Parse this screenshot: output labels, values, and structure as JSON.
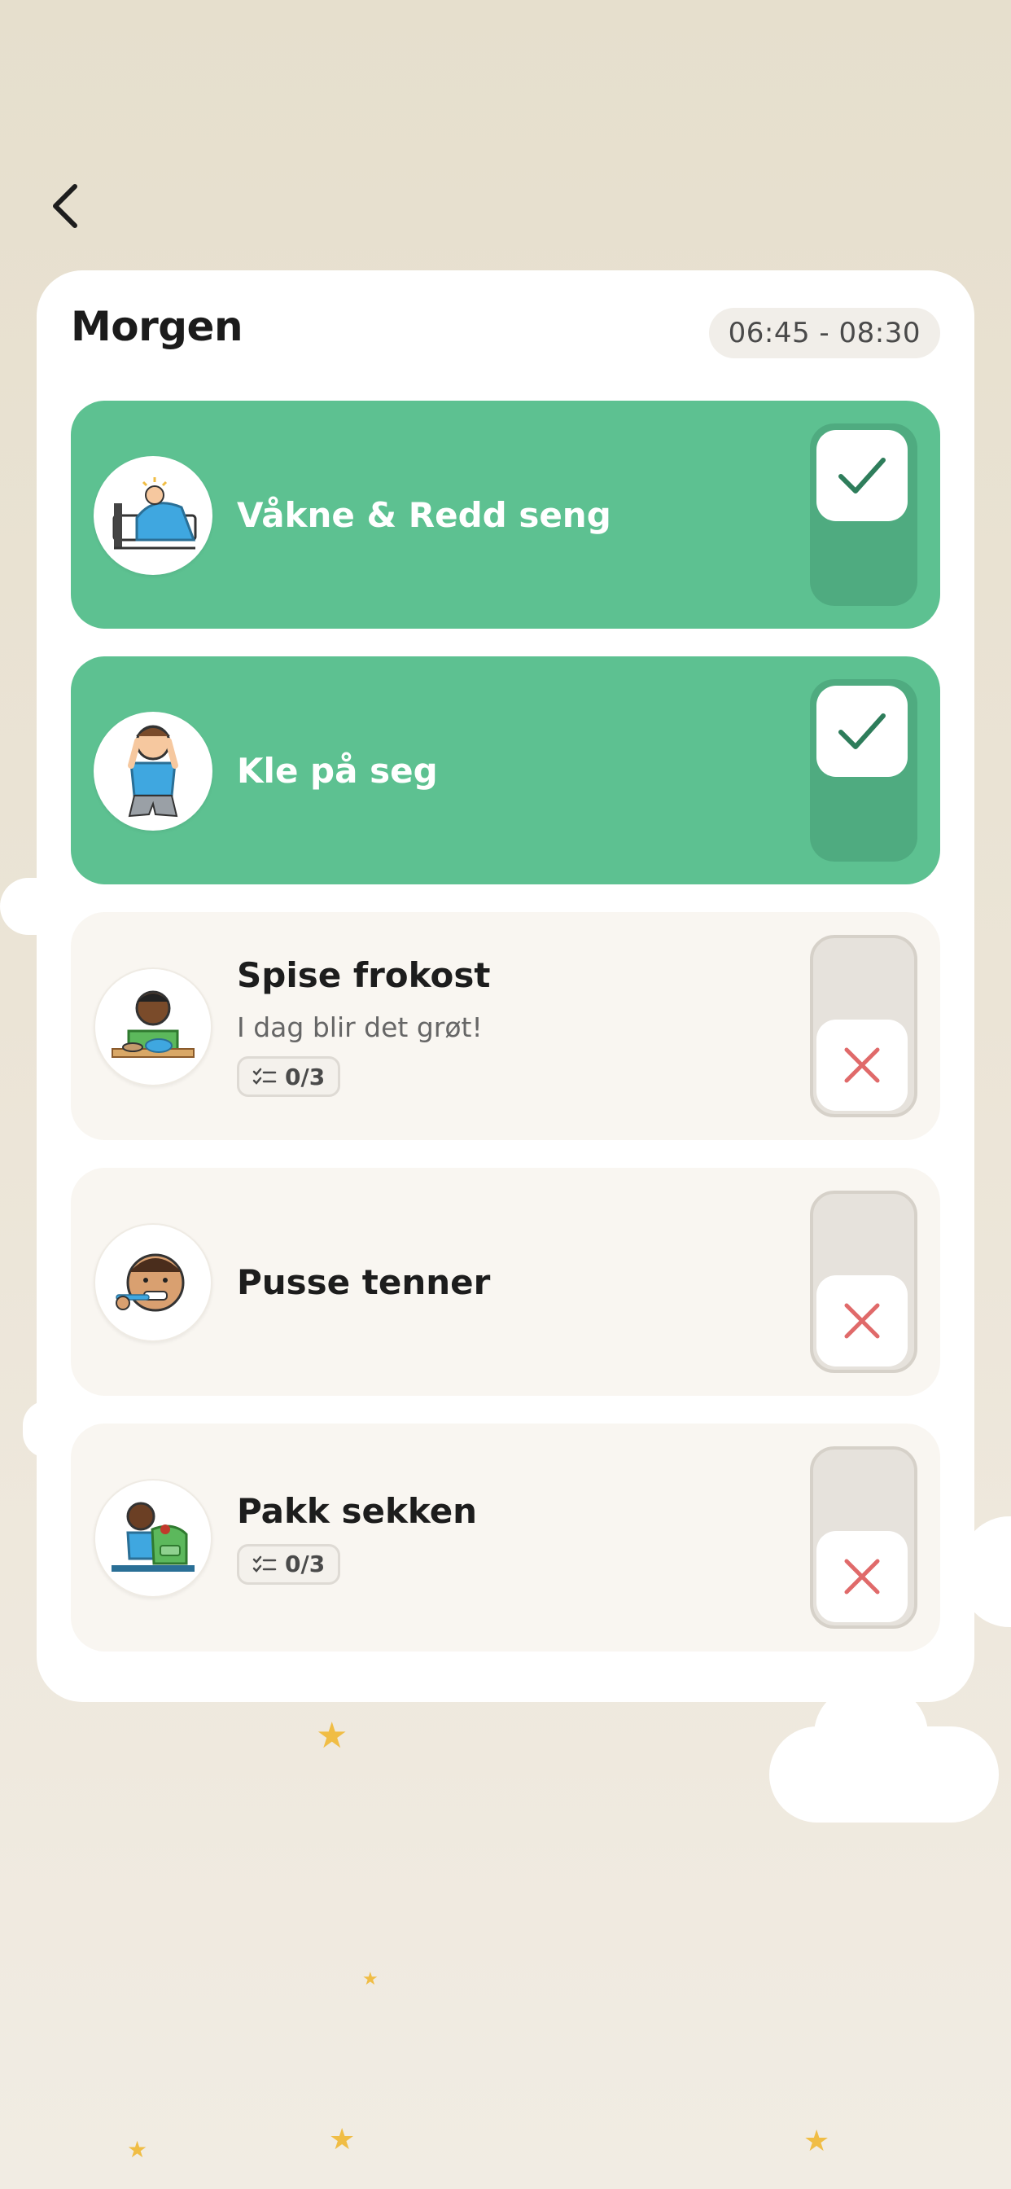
{
  "routine": {
    "title": "Morgen",
    "time_range": "06:45 - 08:30"
  },
  "tasks": [
    {
      "title": "Våkne & Redd seng",
      "done": true,
      "avatar_icon": "wake-up-bed-icon"
    },
    {
      "title": "Kle på seg",
      "done": true,
      "avatar_icon": "getting-dressed-icon"
    },
    {
      "title": "Spise frokost",
      "subtitle": "I dag blir det grøt!",
      "progress": "0/3",
      "done": false,
      "avatar_icon": "eating-breakfast-icon"
    },
    {
      "title": "Pusse tenner",
      "done": false,
      "avatar_icon": "brushing-teeth-icon"
    },
    {
      "title": "Pakk sekken",
      "progress": "0/3",
      "done": false,
      "avatar_icon": "packing-bag-icon"
    }
  ],
  "colors": {
    "done_green": "#5dc191",
    "check_green": "#2e7d5b",
    "cross_red": "#e06a6a",
    "star_yellow": "#f0bd45"
  }
}
